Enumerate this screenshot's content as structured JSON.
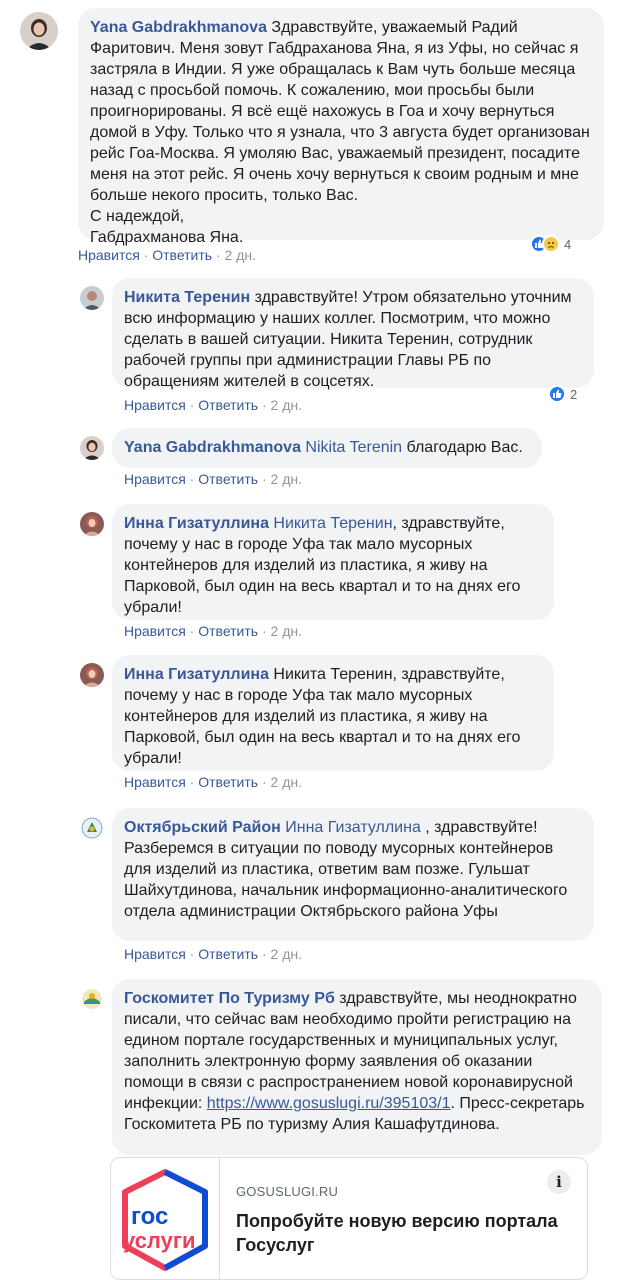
{
  "comments": [
    {
      "author": "Yana Gabdrakhmanova",
      "text": "Здравствуйте, уважаемый Радий Фаритович. Меня зовут Габдраханова Яна, я из Уфы, но сейчас я застряла в Индии. Я уже обращалась к Вам чуть больше месяца назад с просьбой помочь. К сожалению, мои просьбы были проигнорированы. Я всё ещё нахожусь в Гоа и хочу вернуться домой в Уфу. Только что я узнала, что 3 августа будет организован рейс Гоа-Москва. Я умоляю Вас, уважаемый президент, посадите меня на этот рейс. Я очень хочу вернуться к своим родным и мне больше некого просить, только Вас.",
      "sign1": "С надеждой,",
      "sign2": "Габдрахманова Яна.",
      "like": "Нравится",
      "reply": "Ответить",
      "time": "2 дн.",
      "reactions": "4"
    },
    {
      "author": "Никита Теренин",
      "text": "здравствуйте! Утром обязательно уточним всю информацию у наших коллег. Посмотрим, что можно сделать в вашей ситуации. Никита Теренин, сотрудник рабочей группы при администрации Главы РБ по обращениям жителей в соцсетях.",
      "like": "Нравится",
      "reply": "Ответить",
      "time": "2 дн.",
      "reactions": "2"
    },
    {
      "author": "Yana Gabdrakhmanova",
      "mention": "Nikita Terenin",
      "text": "благодарю Вас.",
      "like": "Нравится",
      "reply": "Ответить",
      "time": "2 дн."
    },
    {
      "author": "Инна Гизатуллина",
      "mention": "Никита Теренин",
      "text": ", здравствуйте, почему у нас в городе Уфа так мало мусорных контейнеров для изделий из пластика, я живу на Парковой, был один на весь квартал и то на днях его убрали!",
      "like": "Нравится",
      "reply": "Ответить",
      "time": "2 дн."
    },
    {
      "author": "Инна Гизатуллина",
      "text": "Никита Теренин, здравствуйте, почему у нас в городе Уфа так мало мусорных контейнеров для изделий из пластика, я живу на Парковой, был один на весь квартал и то на днях его убрали!",
      "like": "Нравится",
      "reply": "Ответить",
      "time": "2 дн."
    },
    {
      "author": "Октябрьский Район",
      "mention": "Инна Гизатуллина",
      "text": " , здравствуйте! Разберемся в ситуации по поводу мусорных контейнеров для изделий из пластика, ответим вам позже. Гульшат Шайхутдинова, начальник информационно-аналитического отдела администрации Октябрьского района Уфы",
      "like": "Нравится",
      "reply": "Ответить",
      "time": "2 дн."
    },
    {
      "author": "Госкомитет По Туризму Рб",
      "text": "здравствуйте, мы неоднократно писали, что сейчас вам необходимо пройти регистрацию на едином портале государственных и муниципальных услуг, заполнить электронную форму заявления об оказании помощи в связи с распространением новой коронавирусной инфекции:",
      "link": "https://www.gosuslugi.ru/395103/1",
      "text2": ". Пресс-секретарь Госкомитета РБ по туризму Алия Кашафутдинова."
    }
  ],
  "preview": {
    "logo_top": "гос",
    "logo_bottom": "услуги",
    "domain": "GOSUSLUGI.RU",
    "title": "Попробуйте новую версию портала Госуслуг",
    "info": "i"
  }
}
